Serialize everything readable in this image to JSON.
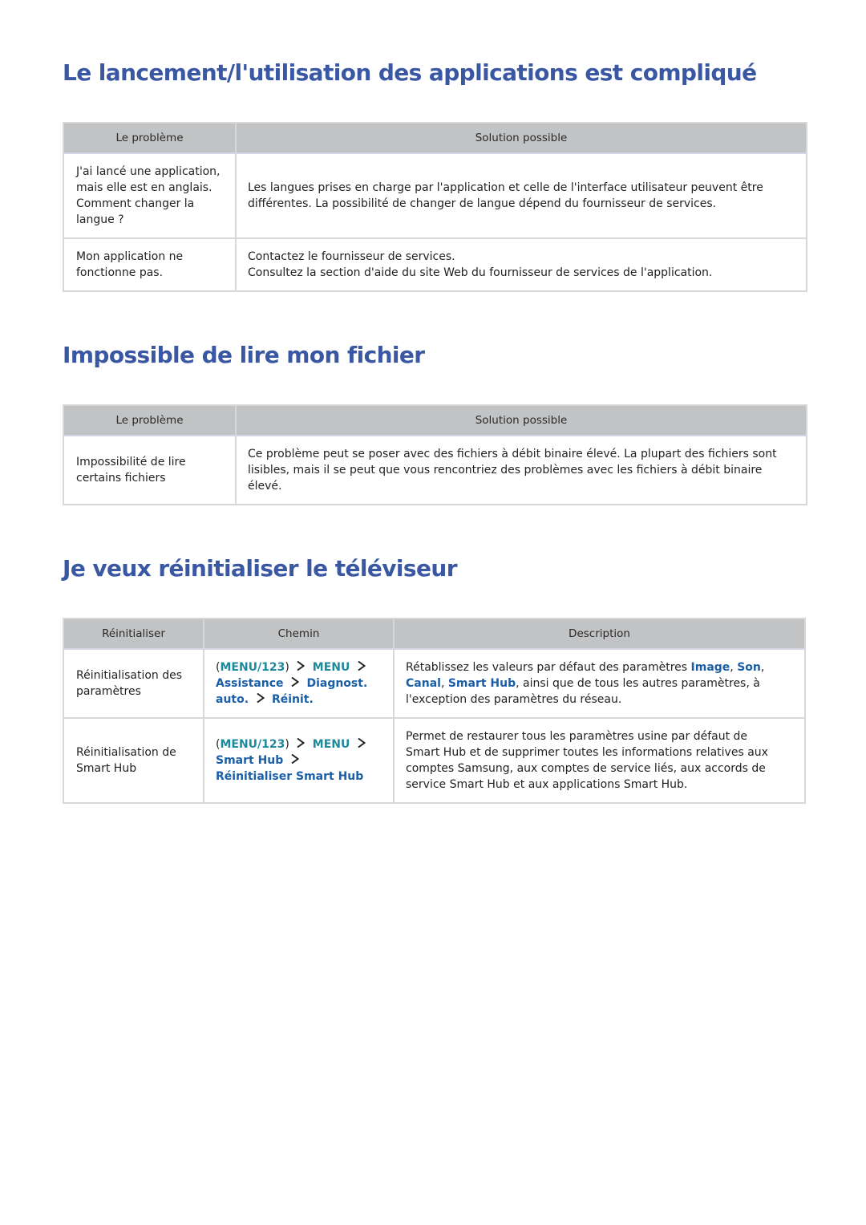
{
  "sections": [
    {
      "title": "Le lancement/l'utilisation des applications est compliqué",
      "headers": [
        "Le problème",
        "Solution possible"
      ],
      "rows": [
        {
          "problem": [
            "J'ai lancé une application,",
            "mais elle est en anglais.",
            "Comment changer la",
            "langue ?"
          ],
          "solution": [
            "Les langues prises en charge par l'application et celle de l'interface utilisateur peuvent être",
            "différentes. La possibilité de changer de langue dépend du fournisseur de services."
          ]
        },
        {
          "problem": [
            "Mon application ne",
            "fonctionne pas."
          ],
          "solution": [
            "Contactez le fournisseur de services.",
            "Consultez la section d'aide du site Web du fournisseur de services de l'application."
          ]
        }
      ]
    },
    {
      "title": "Impossible de lire mon fichier",
      "headers": [
        "Le problème",
        "Solution possible"
      ],
      "rows": [
        {
          "problem": [
            "Impossibilité de lire",
            "certains fichiers"
          ],
          "solution": [
            "Ce problème peut se poser avec des fichiers à débit binaire élevé. La plupart des fichiers sont",
            "lisibles, mais il se peut que vous rencontriez des problèmes avec les fichiers à débit binaire",
            "élevé."
          ]
        }
      ]
    },
    {
      "title": "Je veux réinitialiser le téléviseur",
      "headers": [
        "Réinitialiser",
        "Chemin",
        "Description"
      ],
      "rows": [
        {
          "reset": [
            "Réinitialisation des",
            "paramètres"
          ],
          "path": {
            "open_paren": "(",
            "key": "MENU/123",
            "close_paren": ")",
            "menu": "MENU",
            "steps": [
              "Assistance",
              "Diagnost. auto.",
              "Réinit."
            ]
          },
          "description": {
            "before": "Rétablissez les valeurs par défaut des paramètres ",
            "links": [
              "Image",
              "Son",
              "Canal",
              "Smart Hub"
            ],
            "after": ", ainsi que de tous les autres paramètres, à l'exception des paramètres du réseau."
          }
        },
        {
          "reset": [
            "Réinitialisation de",
            "Smart Hub"
          ],
          "path": {
            "open_paren": "(",
            "key": "MENU/123",
            "close_paren": ")",
            "menu": "MENU",
            "steps": [
              "Smart Hub",
              "Réinitialiser Smart Hub"
            ]
          },
          "description": {
            "lines": [
              "Permet de restaurer tous les paramètres usine par défaut de",
              "Smart Hub et de supprimer toutes les informations relatives aux",
              "comptes Samsung, aux comptes de service liés, aux accords de",
              "service Smart Hub et aux applications Smart Hub."
            ]
          }
        }
      ]
    }
  ],
  "colors": {
    "heading": "#3a57a4",
    "path_key": "#1b8a9c",
    "path_step": "#1a5fa8",
    "header_bg": "#c2c3c4",
    "border": "#d8d8d8"
  }
}
